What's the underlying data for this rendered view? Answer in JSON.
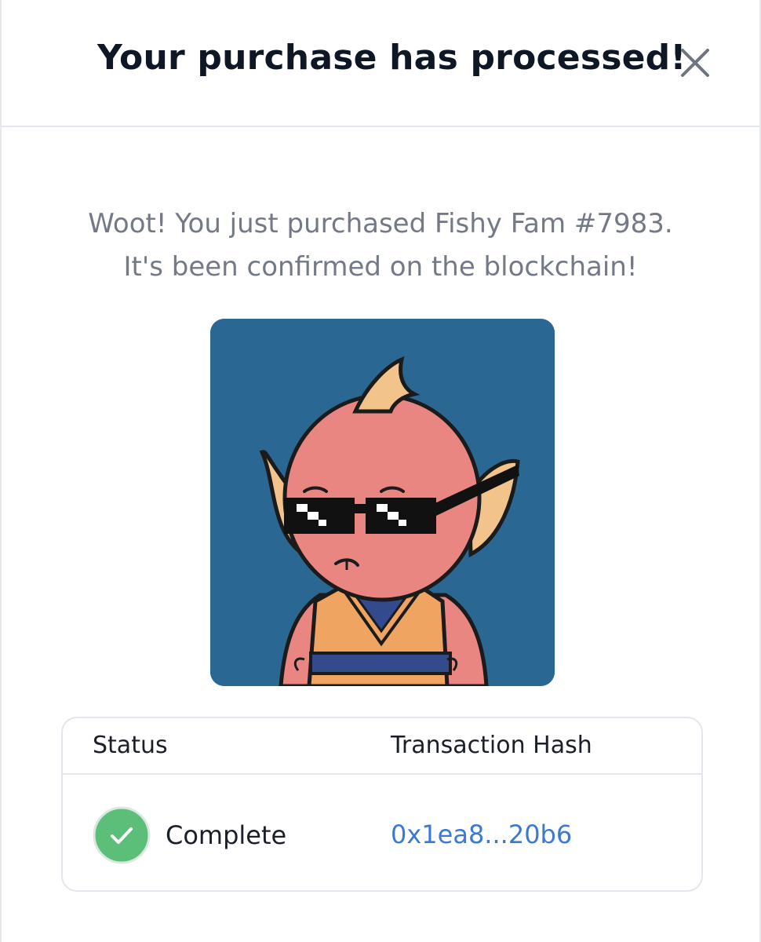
{
  "modal": {
    "title": "Your purchase has processed!",
    "close_icon": "close-icon",
    "message_line1": "Woot! You just purchased Fishy Fam #7983.",
    "message_line2": "It's been confirmed on the blockchain!"
  },
  "nft": {
    "image_icon": "fish-character-with-pixel-sunglasses",
    "background_color": "#2b6793"
  },
  "transaction_table": {
    "headers": {
      "status": "Status",
      "hash": "Transaction Hash"
    },
    "row": {
      "status_icon": "check-circle-icon",
      "status": "Complete",
      "hash": "0x1ea8...20b6"
    }
  },
  "colors": {
    "title": "#0e1726",
    "message": "#737a86",
    "link": "#3a7ad0",
    "success": "#5cbf79",
    "border": "#e3e6ec"
  }
}
